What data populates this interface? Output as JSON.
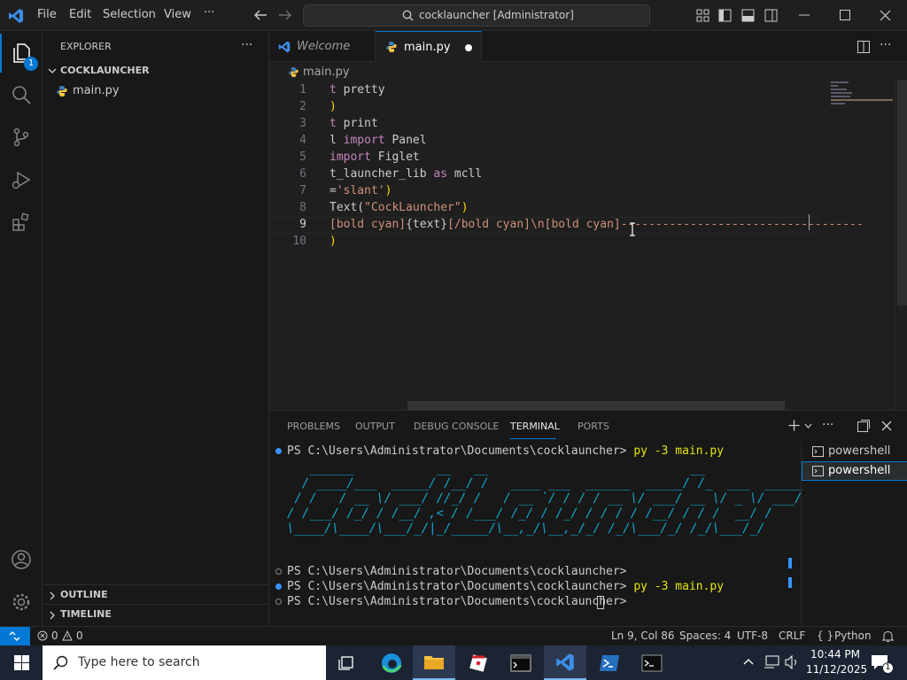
{
  "menu": {
    "file": "File",
    "edit": "Edit",
    "selection": "Selection",
    "view": "View",
    "more": "···"
  },
  "search": {
    "text": "cocklauncher [Administrator]"
  },
  "activity": {
    "badge": "1"
  },
  "sidebar": {
    "title": "EXPLORER",
    "more": "···",
    "folder": "COCKLAUNCHER",
    "files": [
      "main.py"
    ],
    "outline": "OUTLINE",
    "timeline": "TIMELINE"
  },
  "tabs": {
    "welcome": "Welcome",
    "main": "main.py"
  },
  "breadcrumb": "main.py",
  "editor": {
    "lines": [
      {
        "n": "1",
        "segs": [
          {
            "t": "t ",
            "c": "#c586c0"
          },
          {
            "t": "pretty",
            "c": "#cccccc"
          }
        ]
      },
      {
        "n": "2",
        "segs": [
          {
            "t": ")",
            "c": "#ffd700"
          }
        ]
      },
      {
        "n": "3",
        "segs": [
          {
            "t": "t ",
            "c": "#c586c0"
          },
          {
            "t": "print",
            "c": "#cccccc"
          }
        ]
      },
      {
        "n": "4",
        "segs": [
          {
            "t": "l ",
            "c": "#cccccc"
          },
          {
            "t": "import",
            "c": "#c586c0"
          },
          {
            "t": " Panel",
            "c": "#cccccc"
          }
        ]
      },
      {
        "n": "5",
        "segs": [
          {
            "t": "import",
            "c": "#c586c0"
          },
          {
            "t": " Figlet",
            "c": "#cccccc"
          }
        ]
      },
      {
        "n": "6",
        "segs": [
          {
            "t": "t_launcher_lib ",
            "c": "#cccccc"
          },
          {
            "t": "as",
            "c": "#c586c0"
          },
          {
            "t": " mcll",
            "c": "#cccccc"
          }
        ]
      },
      {
        "n": "7",
        "segs": [
          {
            "t": "=",
            "c": "#cccccc"
          },
          {
            "t": "'slant'",
            "c": "#ce9178"
          },
          {
            "t": ")",
            "c": "#ffd700"
          }
        ]
      },
      {
        "n": "8",
        "segs": [
          {
            "t": "Text(",
            "c": "#cccccc"
          },
          {
            "t": "\"CockLauncher\"",
            "c": "#ce9178"
          },
          {
            "t": ")",
            "c": "#ffd700"
          }
        ]
      },
      {
        "n": "9",
        "segs": [
          {
            "t": "[bold cyan]",
            "c": "#ce9178"
          },
          {
            "t": "{text}",
            "c": "#cccccc"
          },
          {
            "t": "[/bold cyan]\\n[bold cyan]",
            "c": "#ce9178"
          },
          {
            "t": "-----------------------------------",
            "c": "#ce9178"
          }
        ]
      },
      {
        "n": "10",
        "segs": [
          {
            "t": ")",
            "c": "#ffd700"
          }
        ]
      }
    ]
  },
  "panel": {
    "tabs": [
      "PROBLEMS",
      "OUTPUT",
      "DEBUG CONSOLE",
      "TERMINAL",
      "PORTS"
    ],
    "prompt1": "PS C:\\Users\\Administrator\\Documents\\cocklauncher>",
    "cmd1": " py -3 main.py",
    "figlet": [
      "   ______           __   __                           __             ",
      "  / ____/___  _____/ /__/ /   ____ ___  ______  _____/ /_  ___  _____",
      " / /   / __ \\/ ___/ //_/ /   / __ `/ / / / __ \\/ ___/ __ \\/ _ \\/ ___/",
      "/ /___/ /_/ / /__/ ,< / /___/ /_/ / /_/ / / / / /__/ / / /  __/ /    ",
      "\\____/\\____/\\___/_/|_/_____/\\__,_/\\__,_/_/ /_/\\___/_/ /_/\\___/_/     "
    ],
    "prompt2": "PS C:\\Users\\Administrator\\Documents\\cocklauncher>",
    "prompt3": "PS C:\\Users\\Administrator\\Documents\\cocklauncher>",
    "cmd3": " py -3 main.py",
    "prompt4": "PS C:\\Users\\Administrator\\Documents\\cocklauncher>",
    "terminals": [
      "powershell",
      "powershell"
    ]
  },
  "status": {
    "errors": "0",
    "warnings": "0",
    "position": "Ln 9, Col 86",
    "spaces": "Spaces: 4",
    "encoding": "UTF-8",
    "eol": "CRLF",
    "language": "Python"
  },
  "taskbar": {
    "search_placeholder": "Type here to search",
    "time": "10:44 PM",
    "date": "11/12/2025",
    "notif_count": "1"
  }
}
